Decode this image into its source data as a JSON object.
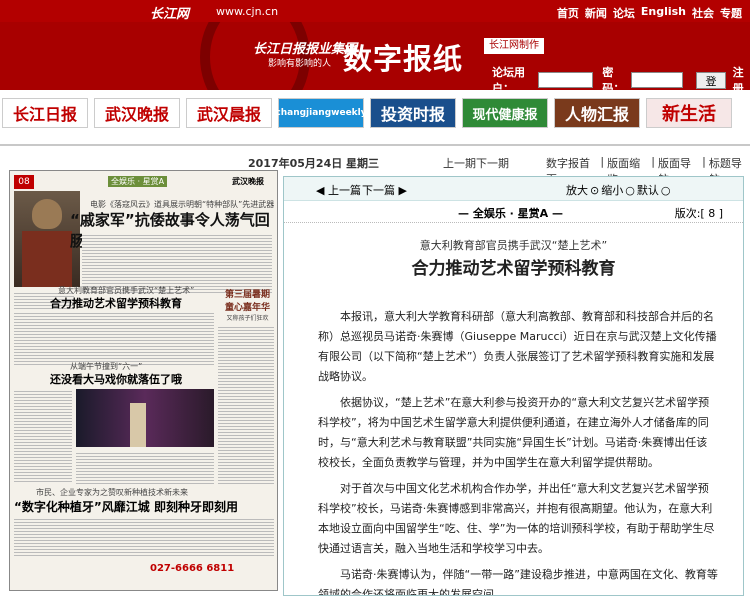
{
  "topbar": {
    "logo": "长江网",
    "site": "www.cjn.cn",
    "nav": [
      "首页",
      "新闻",
      "论坛",
      "English",
      "社会",
      "专题"
    ]
  },
  "banner": {
    "brand": "长江日报报业集团",
    "slogan": "影响有影响的人",
    "title": "数字报纸",
    "made_by": "长江网制作",
    "login_label": "论坛用户：",
    "password_label": "密码：",
    "login_button": "登陆",
    "register": "注册"
  },
  "papers": [
    {
      "name": "长江日报",
      "color": "#c00000",
      "bg": "#fff"
    },
    {
      "name": "武汉晚报",
      "color": "#c00000",
      "bg": "#fff"
    },
    {
      "name": "武汉晨报",
      "color": "#c00000",
      "bg": "#fff"
    },
    {
      "name": "changjiangweekly",
      "color": "#fff",
      "bg": "#1a8fd6"
    },
    {
      "name": "投资时报",
      "color": "#fff",
      "bg": "#1a4f8c"
    },
    {
      "name": "现代健康报",
      "color": "#fff",
      "bg": "#2f8a37"
    },
    {
      "name": "人物汇报",
      "color": "#fff",
      "bg": "#7a3a1c"
    },
    {
      "name": "新生活",
      "color": "#c00000",
      "bg": "#fff"
    }
  ],
  "date": {
    "text": "2017年05月24日 星期三",
    "prev_issue": "上一期",
    "next_issue": "下一期"
  },
  "nav": {
    "home": "数字报首页",
    "layout_view": "版面缩览",
    "layout_nav": "版面导航",
    "title_nav": "标题导航"
  },
  "toolbar": {
    "prev": "上一篇",
    "next": "下一篇",
    "zoom_in": "放大",
    "zoom_out": "缩小",
    "default": "默认"
  },
  "section": {
    "title": "全娱乐 · 星赏A",
    "page_label": "版次:[ 8 ]"
  },
  "newspaper": {
    "page_no": "08",
    "section": "全娱乐 · 星赏A",
    "masthead": "武汉晚报",
    "headline1_sub": "电影《落寇风云》道具展示明朝“特种部队”先进武器",
    "headline1": "“戚家军”抗倭故事令人荡气回肠",
    "headline2_sub": "意大利教育部官员携手武汉“楚上艺术”",
    "headline2": "合力推动艺术留学预科教育",
    "box_title1": "第三届暑期",
    "box_title2": "童心嘉年华",
    "box_sub": "又称孩子们狂欢",
    "headline3_sub": "从端午节撞到“六一”",
    "headline3": "还没看大马戏你就落伍了哦",
    "headline4_sub": "市民、企业专家为之赞叹新种植技术新未来",
    "headline4": "“数字化种植牙”风靡江城  即刻种牙即刻用",
    "hotline": "027-6666 6811"
  },
  "article": {
    "subtitle": "意大利教育部官员携手武汉“楚上艺术”",
    "title": "合力推动艺术留学预科教育",
    "paragraphs": [
      "本报讯，意大利大学教育科研部（意大利高教部、教育部和科技部合并后的名称）总巡视员马诺奇·朱赛博（Giuseppe Marucci）近日在京与武汉楚上文化传播有限公司（以下简称“楚上艺术”）负责人张展签订了艺术留学预科教育实施和发展战略协议。",
      "依据协议，“楚上艺术”在意大利参与投资开办的“意大利文艺复兴艺术留学预科学校”，将为中国艺术生留学意大利提供便利通道，在建立海外人才储备库的同时，与“意大利艺术与教育联盟”共同实施“异国生长”计划。马诺奇·朱赛博出任该校校长，全面负责教学与管理，并为中国学生在意大利留学提供帮助。",
      "对于首次与中国文化艺术机构合作办学，并出任“意大利文艺复兴艺术留学预科学校”校长，马诺奇·朱赛博感到非常高兴，并抱有很高期望。他认为，在意大利本地设立面向中国留学生“吃、住、学”为一体的培训预科学校，有助于帮助学生尽快通过语言关，融入当地生活和学校学习中去。",
      "马诺奇·朱赛博认为，伴随“一带一路”建设稳步推进，中意两国在文化、教育等领域的合作还将面临更大的发展空间。"
    ]
  }
}
